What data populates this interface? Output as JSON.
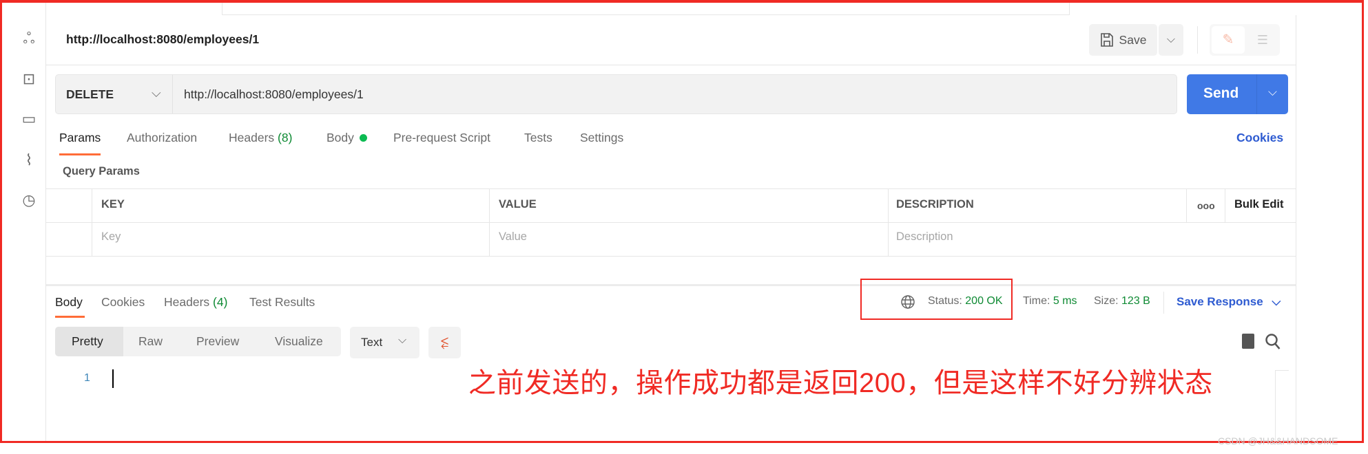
{
  "request_title": "http://localhost:8080/employees/1",
  "save_label": "Save",
  "method": "DELETE",
  "url": "http://localhost:8080/employees/1",
  "send_label": "Send",
  "request_tabs": [
    {
      "label": "Params",
      "active": true
    },
    {
      "label": "Authorization"
    },
    {
      "label": "Headers",
      "count": "(8)"
    },
    {
      "label": "Body",
      "indicator_color": "#0cbb52"
    },
    {
      "label": "Pre-request Script"
    },
    {
      "label": "Tests"
    },
    {
      "label": "Settings"
    }
  ],
  "cookies_link": "Cookies",
  "query_params": {
    "title": "Query Params",
    "columns": [
      "KEY",
      "VALUE",
      "DESCRIPTION"
    ],
    "bulk_edit": "Bulk Edit",
    "placeholders": [
      "Key",
      "Value",
      "Description"
    ]
  },
  "response_tabs": [
    {
      "label": "Body",
      "active": true
    },
    {
      "label": "Cookies"
    },
    {
      "label": "Headers",
      "count": "(4)"
    },
    {
      "label": "Test Results"
    }
  ],
  "response_meta": {
    "status_label": "Status:",
    "status_value": "200 OK",
    "time_label": "Time:",
    "time_value": "5 ms",
    "size_label": "Size:",
    "size_value": "123 B",
    "save_response": "Save Response"
  },
  "view_modes": [
    "Pretty",
    "Raw",
    "Preview",
    "Visualize"
  ],
  "format": "Text",
  "line_number": "1",
  "annotation": "之前发送的，操作成功都是返回200，但是这样不好分辨状态",
  "watermark": "CSDN @JH&&HANDSOME",
  "colors": {
    "accent": "#ff6c37",
    "send": "#4079e6",
    "link": "#2e5bd1",
    "annotation": "#f02a24",
    "success": "#0e8a33"
  }
}
